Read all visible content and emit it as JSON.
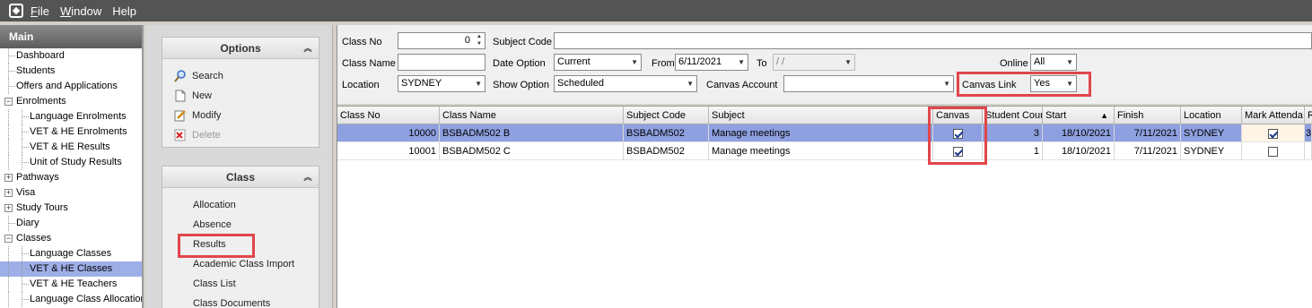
{
  "menubar": {
    "items": [
      {
        "label": "File",
        "underline": "F",
        "rest": "ile"
      },
      {
        "label": "Window",
        "underline": "W",
        "rest": "indow"
      },
      {
        "label": "Help",
        "underline": "",
        "rest": "Help"
      }
    ]
  },
  "leftnav": {
    "header": "Main",
    "items": [
      {
        "label": "Dashboard",
        "level": 0
      },
      {
        "label": "Students",
        "level": 0
      },
      {
        "label": "Offers and Applications",
        "level": 0
      },
      {
        "label": "Enrolments",
        "level": 0,
        "expander": "−"
      },
      {
        "label": "Language Enrolments",
        "level": 1
      },
      {
        "label": "VET & HE Enrolments",
        "level": 1
      },
      {
        "label": "VET & HE Results",
        "level": 1
      },
      {
        "label": "Unit of Study Results",
        "level": 1
      },
      {
        "label": "Pathways",
        "level": 0,
        "expander": "+"
      },
      {
        "label": "Visa",
        "level": 0,
        "expander": "+"
      },
      {
        "label": "Study Tours",
        "level": 0,
        "expander": "+"
      },
      {
        "label": "Diary",
        "level": 0
      },
      {
        "label": "Classes",
        "level": 0,
        "expander": "−"
      },
      {
        "label": "Language Classes",
        "level": 1
      },
      {
        "label": "VET & HE Classes",
        "level": 1,
        "selected": true
      },
      {
        "label": "VET & HE Teachers",
        "level": 1
      },
      {
        "label": "Language Class Allocation",
        "level": 1
      }
    ]
  },
  "options": {
    "title": "Options",
    "tasks": [
      {
        "label": "Search",
        "icon": "search-icon"
      },
      {
        "label": "New",
        "icon": "new-document-icon"
      },
      {
        "label": "Modify",
        "icon": "edit-icon"
      },
      {
        "label": "Delete",
        "icon": "delete-icon",
        "disabled": true
      }
    ]
  },
  "classgroup": {
    "title": "Class",
    "tasks": [
      "Allocation",
      "Absence",
      "Results",
      "Academic Class Import",
      "Class List",
      "Class Documents"
    ]
  },
  "filters": {
    "class_no_label": "Class No",
    "class_no_value": "0",
    "subject_code_label": "Subject Code",
    "subject_code_value": "",
    "class_name_label": "Class Name",
    "class_name_value": "",
    "date_option_label": "Date Option",
    "date_option_value": "Current",
    "from_label": "From",
    "from_value": "6/11/2021",
    "to_label": "To",
    "to_value": " /  /",
    "online_label": "Online",
    "online_value": "All",
    "location_label": "Location",
    "location_value": "SYDNEY",
    "show_option_label": "Show Option",
    "show_option_value": "Scheduled",
    "canvas_account_label": "Canvas Account",
    "canvas_account_value": "",
    "canvas_link_label": "Canvas Link",
    "canvas_link_value": "Yes"
  },
  "grid": {
    "columns": [
      "Class No",
      "Class Name",
      "Subject Code",
      "Subject",
      "Canvas",
      "Student Cour",
      "Start",
      "Finish",
      "Location",
      "Mark Attenda",
      "R"
    ],
    "sort_indicator": "▲",
    "rows": [
      {
        "class_no": "10000",
        "class_name": "BSBADM502 B",
        "subject_code": "BSBADM502",
        "subject": "Manage meetings",
        "canvas": true,
        "student_count": "3",
        "start": "18/10/2021",
        "finish": "7/11/2021",
        "location": "SYDNEY",
        "mark_attendance": true,
        "r": "3",
        "selected": true
      },
      {
        "class_no": "10001",
        "class_name": "BSBADM502 C",
        "subject_code": "BSBADM502",
        "subject": "Manage meetings",
        "canvas": true,
        "student_count": "1",
        "start": "18/10/2021",
        "finish": "7/11/2021",
        "location": "SYDNEY",
        "mark_attendance": false,
        "r": "",
        "selected": false
      }
    ]
  },
  "colors": {
    "highlight_box": "#e0464b",
    "selected_row": "#8ea0e0",
    "selected_nav": "#9eaee6"
  }
}
